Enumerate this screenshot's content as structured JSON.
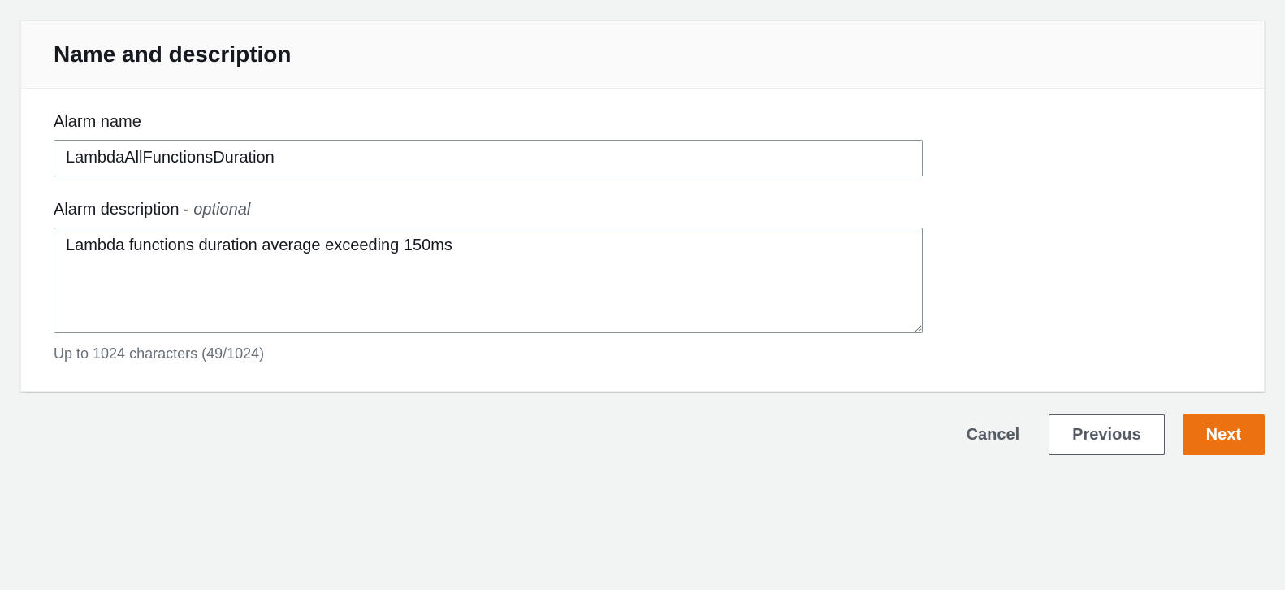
{
  "section": {
    "title": "Name and description"
  },
  "form": {
    "alarm_name": {
      "label": "Alarm name",
      "value": "LambdaAllFunctionsDuration"
    },
    "alarm_description": {
      "label_main": "Alarm description",
      "label_optional_separator": " - ",
      "label_optional": "optional",
      "value": "Lambda functions duration average exceeding 150ms",
      "hint": "Up to 1024 characters (49/1024)"
    }
  },
  "buttons": {
    "cancel": "Cancel",
    "previous": "Previous",
    "next": "Next"
  }
}
